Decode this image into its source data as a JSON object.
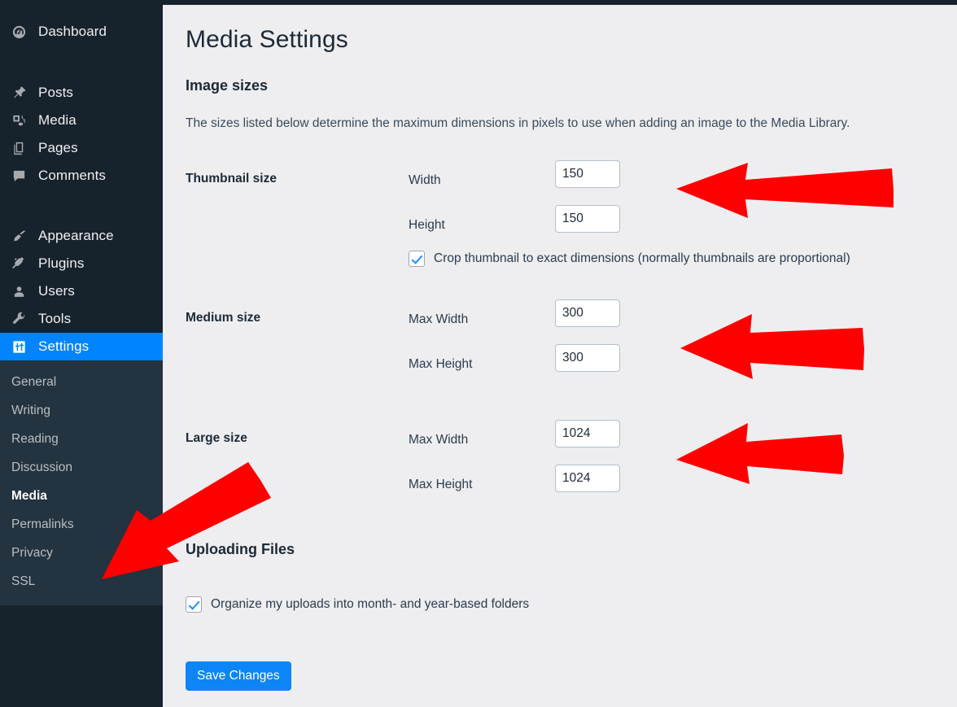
{
  "app": {
    "accent_blue": "#0084ff",
    "sidebar_bg": "#16222c",
    "submenu_bg": "#23333f",
    "content_bg": "#eeeef0",
    "annotation_color": "#ff0000"
  },
  "sidebar": {
    "items": [
      {
        "label": "Dashboard",
        "icon": "dashboard-icon",
        "current": false
      },
      {
        "label": "Posts",
        "icon": "pin-icon",
        "current": false
      },
      {
        "label": "Media",
        "icon": "media-icon",
        "current": false
      },
      {
        "label": "Pages",
        "icon": "pages-icon",
        "current": false
      },
      {
        "label": "Comments",
        "icon": "comment-icon",
        "current": false
      },
      {
        "label": "Appearance",
        "icon": "brush-icon",
        "current": false
      },
      {
        "label": "Plugins",
        "icon": "plug-icon",
        "current": false
      },
      {
        "label": "Users",
        "icon": "user-icon",
        "current": false
      },
      {
        "label": "Tools",
        "icon": "wrench-icon",
        "current": false
      },
      {
        "label": "Settings",
        "icon": "settings-icon",
        "current": true
      }
    ],
    "submenu": [
      {
        "label": "General",
        "current": false
      },
      {
        "label": "Writing",
        "current": false
      },
      {
        "label": "Reading",
        "current": false
      },
      {
        "label": "Discussion",
        "current": false
      },
      {
        "label": "Media",
        "current": true
      },
      {
        "label": "Permalinks",
        "current": false
      },
      {
        "label": "Privacy",
        "current": false
      },
      {
        "label": "SSL",
        "current": false
      }
    ]
  },
  "main": {
    "page_title": "Media Settings",
    "image_sizes": {
      "heading": "Image sizes",
      "description": "The sizes listed below determine the maximum dimensions in pixels to use when adding an image to the Media Library.",
      "groups": [
        {
          "label": "Thumbnail size",
          "fields": [
            {
              "label": "Width",
              "value": "150"
            },
            {
              "label": "Height",
              "value": "150"
            }
          ],
          "checkbox": {
            "label": "Crop thumbnail to exact dimensions (normally thumbnails are proportional)",
            "checked": true
          }
        },
        {
          "label": "Medium size",
          "fields": [
            {
              "label": "Max Width",
              "value": "300"
            },
            {
              "label": "Max Height",
              "value": "300"
            }
          ]
        },
        {
          "label": "Large size",
          "fields": [
            {
              "label": "Max Width",
              "value": "1024"
            },
            {
              "label": "Max Height",
              "value": "1024"
            }
          ]
        }
      ]
    },
    "uploading_files": {
      "heading": "Uploading Files",
      "checkbox": {
        "label": "Organize my uploads into month- and year-based folders",
        "checked": true
      }
    },
    "save_label": "Save Changes"
  },
  "annotations": [
    {
      "name": "arrow-thumbnail-size",
      "direction": "left"
    },
    {
      "name": "arrow-medium-size",
      "direction": "left"
    },
    {
      "name": "arrow-large-size",
      "direction": "left"
    },
    {
      "name": "arrow-media-submenu",
      "direction": "down-left"
    }
  ]
}
